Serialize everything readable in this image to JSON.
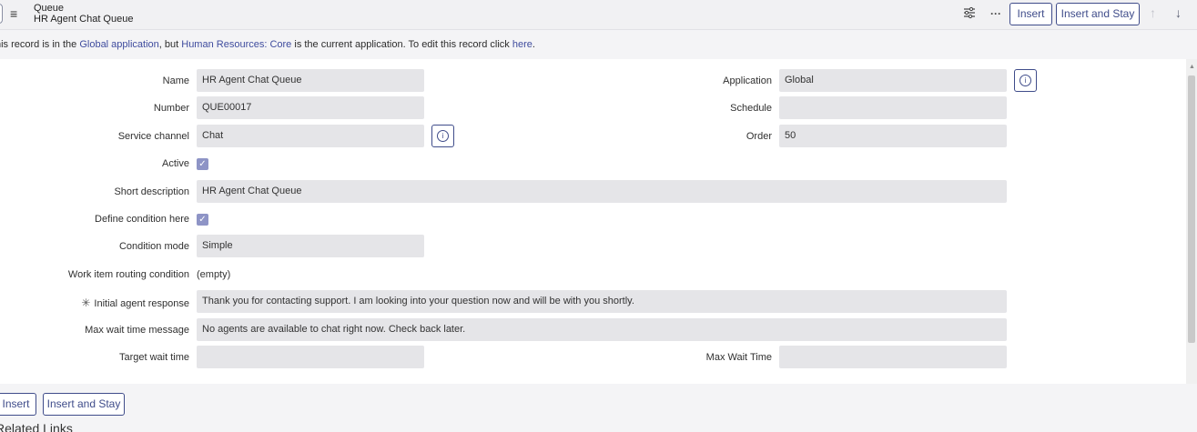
{
  "header": {
    "title": "Queue",
    "record_name": "HR Agent Chat Queue",
    "insert_label": "Insert",
    "insert_stay_label": "Insert and Stay"
  },
  "infobar": {
    "prefix": "his record is in the ",
    "app_link": "Global application",
    "middle": ", but ",
    "current_app": "Human Resources: Core",
    "suffix": " is the current application. To edit this record click ",
    "here_link": "here",
    "end": "."
  },
  "form": {
    "name_label": "Name",
    "name_value": "HR Agent Chat Queue",
    "number_label": "Number",
    "number_value": "QUE00017",
    "service_channel_label": "Service channel",
    "service_channel_value": "Chat",
    "active_label": "Active",
    "short_desc_label": "Short description",
    "short_desc_value": "HR Agent Chat Queue",
    "define_condition_label": "Define condition here",
    "condition_mode_label": "Condition mode",
    "condition_mode_value": "Simple",
    "routing_condition_label": "Work item routing condition",
    "routing_condition_value": "(empty)",
    "initial_response_label": "Initial agent response",
    "initial_response_value": "Thank you for contacting support. I am looking into your question now and will be with you shortly.",
    "max_wait_msg_label": "Max wait time message",
    "max_wait_msg_value": "No agents are available to chat right now. Check back later.",
    "target_wait_label": "Target wait time",
    "target_wait_value": "",
    "application_label": "Application",
    "application_value": "Global",
    "schedule_label": "Schedule",
    "schedule_value": "",
    "order_label": "Order",
    "order_value": "50",
    "max_wait_time_label": "Max Wait Time",
    "max_wait_time_value": ""
  },
  "footer": {
    "insert_label": "Insert",
    "insert_stay_label": "Insert and Stay",
    "related_links": "Related Links"
  },
  "icons": {
    "menu": "hamburger-menu-icon",
    "personalize": "sliders-icon",
    "more": "ellipsis-icon",
    "up": "arrow-up-icon",
    "down": "arrow-down-icon",
    "info": "info-circle-icon",
    "check": "checkmark-icon",
    "required": "asterisk-icon"
  },
  "colors": {
    "accent": "#3f4c8a",
    "link": "#3f4c9e",
    "field_bg": "#e5e5e8",
    "checkbox": "#8e94c6"
  }
}
